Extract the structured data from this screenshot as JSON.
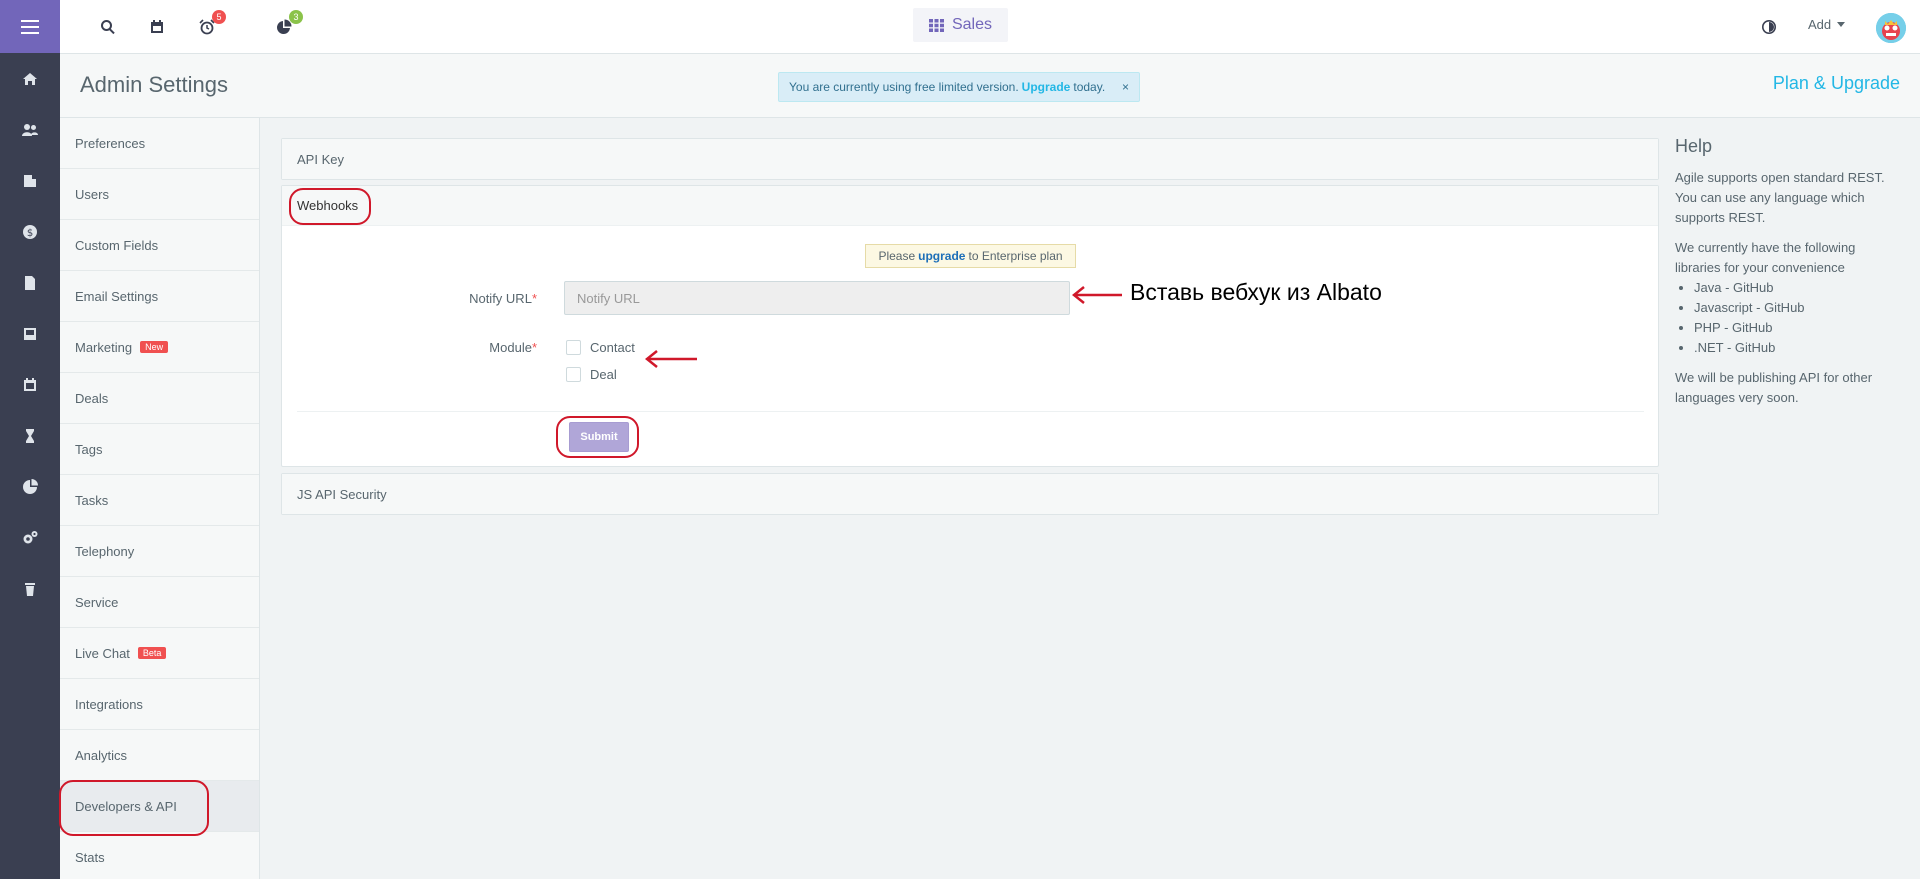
{
  "topbar": {
    "reminders_count": "5",
    "stats_count": "3",
    "app_switch_label": "Sales",
    "add_label": "Add",
    "colors": {
      "reminder_badge": "#f05050",
      "stats_badge": "#27c24c",
      "accent": "#7266ba"
    }
  },
  "header": {
    "title": "Admin Settings",
    "notice_prefix": "You are currently using free limited version.",
    "notice_link": "Upgrade",
    "notice_suffix": "today.",
    "notice_close": "×",
    "plan_link": "Plan & Upgrade"
  },
  "rail": {
    "icons": [
      "home-icon",
      "contacts-icon",
      "companies-icon",
      "deals-icon",
      "documents-icon",
      "cases-icon",
      "calendar-icon",
      "activities-icon",
      "reports-icon",
      "settings-icon",
      "trash-icon"
    ]
  },
  "menu": {
    "items": [
      {
        "label": "Preferences"
      },
      {
        "label": "Users"
      },
      {
        "label": "Custom Fields"
      },
      {
        "label": "Email Settings"
      },
      {
        "label": "Marketing",
        "tag": "New"
      },
      {
        "label": "Deals"
      },
      {
        "label": "Tags"
      },
      {
        "label": "Tasks"
      },
      {
        "label": "Telephony"
      },
      {
        "label": "Service"
      },
      {
        "label": "Live Chat",
        "tag": "Beta"
      },
      {
        "label": "Integrations"
      },
      {
        "label": "Analytics"
      },
      {
        "label": "Developers & API"
      },
      {
        "label": "Stats"
      }
    ]
  },
  "main": {
    "api_key_title": "API Key",
    "webhooks_title": "Webhooks",
    "upgrade_prefix": "Please",
    "upgrade_link": "upgrade",
    "upgrade_suffix": "to Enterprise plan",
    "notify_label": "Notify URL",
    "notify_placeholder": "Notify URL",
    "module_label": "Module",
    "required_mark": "*",
    "module_options": [
      "Contact",
      "Deal"
    ],
    "submit_label": "Submit",
    "js_security_title": "JS API Security"
  },
  "help": {
    "title": "Help",
    "p1": "Agile supports open standard REST. You can use any language which supports REST.",
    "p2": "We currently have the following libraries for your convenience",
    "libraries": [
      "Java - GitHub",
      "Javascript - GitHub",
      "PHP - GitHub",
      ".NET - GitHub"
    ],
    "p3": "We will be publishing API for other languages very soon."
  },
  "annotation": {
    "text": "Вставь вебхук из Albato",
    "color": "#d0182a"
  }
}
